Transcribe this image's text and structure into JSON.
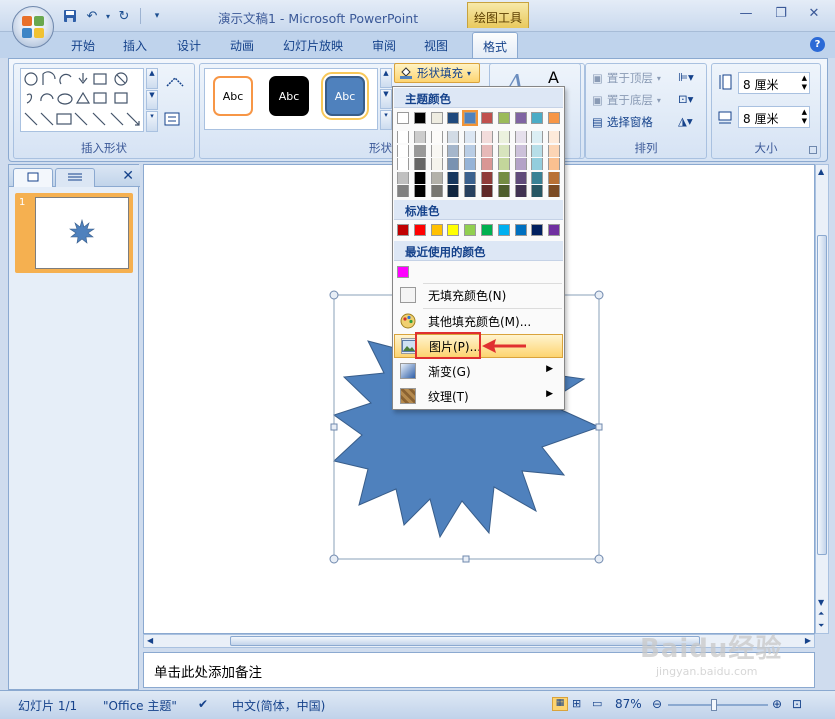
{
  "window": {
    "title": "演示文稿1 - Microsoft PowerPoint",
    "context_tab": "绘图工具"
  },
  "tabs": [
    "开始",
    "插入",
    "设计",
    "动画",
    "幻灯片放映",
    "审阅",
    "视图",
    "格式"
  ],
  "active_tab": "格式",
  "ribbon": {
    "insert_shapes_label": "插入形状",
    "shape_styles_label": "形状样式",
    "style_sample_text": "Abc",
    "shape_fill_button": "形状填充",
    "arrange": {
      "label": "排列",
      "bring_to_front": "置于顶层",
      "send_to_back": "置于底层",
      "selection_pane": "选择窗格"
    },
    "size": {
      "label": "大小",
      "height": "8 厘米",
      "width": "8 厘米"
    }
  },
  "fill_menu": {
    "theme_colors_header": "主题颜色",
    "standard_colors_header": "标准色",
    "recent_colors_header": "最近使用的颜色",
    "theme_colors": [
      "#ffffff",
      "#000000",
      "#eeece1",
      "#1f497d",
      "#4f81bd",
      "#c0504d",
      "#9bbb59",
      "#8064a2",
      "#4bacc6",
      "#f79646"
    ],
    "standard_colors": [
      "#c00000",
      "#ff0000",
      "#ffc000",
      "#ffff00",
      "#92d050",
      "#00b050",
      "#00b0f0",
      "#0070c0",
      "#002060",
      "#7030a0"
    ],
    "recent_colors": [
      "#ff00ff"
    ],
    "items": [
      {
        "label": "无填充颜色(N)"
      },
      {
        "label": "其他填充颜色(M)..."
      },
      {
        "label": "图片(P)..."
      },
      {
        "label": "渐变(G)"
      },
      {
        "label": "纹理(T)"
      }
    ]
  },
  "slide_pane": {
    "slide_number": "1"
  },
  "notes_placeholder": "单击此处添加备注",
  "status": {
    "slide_info": "幻灯片 1/1",
    "theme": "\"Office 主题\"",
    "language": "中文(简体，中国)",
    "zoom": "87%"
  },
  "colors": {
    "shape_fill": "#4f81bd",
    "shape_stroke": "#385d8a",
    "highlight": "#fdd470",
    "annotation_red": "#e03030"
  },
  "watermark": {
    "brand": "Baidu经验",
    "url": "jingyan.baidu.com"
  }
}
